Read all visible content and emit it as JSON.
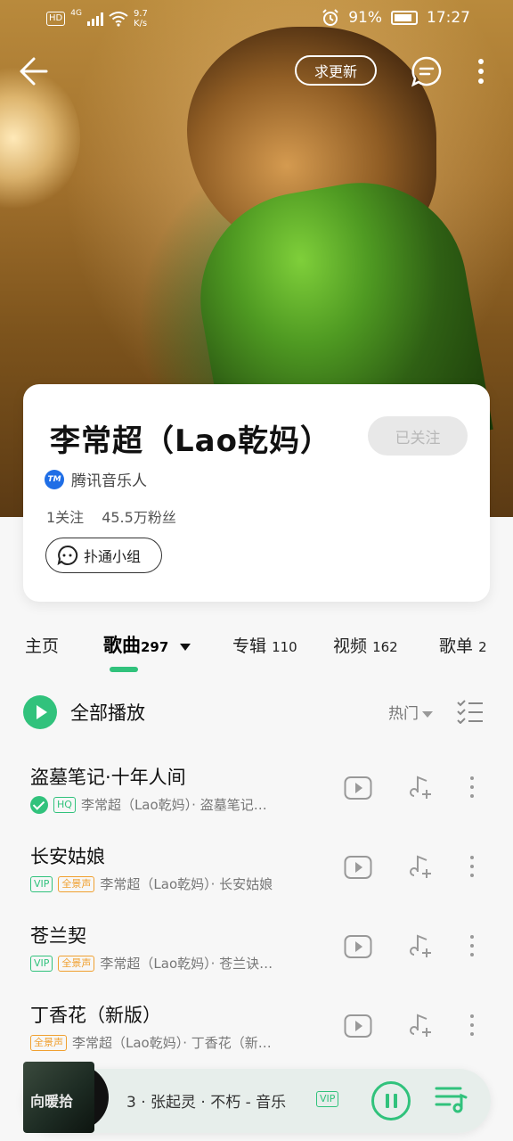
{
  "status_bar": {
    "hd": "HD",
    "network": "4G",
    "speed_value": "9.7",
    "speed_unit": "K/s",
    "battery": "91%",
    "time": "17:27"
  },
  "topnav": {
    "request_update": "求更新"
  },
  "artist": {
    "name": "李常超（Lao乾妈）",
    "follow_state": "已关注",
    "cert_label": "腾讯音乐人",
    "cert_icon_text": "TM",
    "following": "1关注",
    "fans": "45.5万粉丝",
    "group_label": "扑通小组"
  },
  "tabs": [
    {
      "label": "主页",
      "count": ""
    },
    {
      "label": "歌曲",
      "count": "297"
    },
    {
      "label": "专辑",
      "count": "110"
    },
    {
      "label": "视频",
      "count": "162"
    },
    {
      "label": "歌单",
      "count": "2"
    }
  ],
  "list_header": {
    "play_all": "全部播放",
    "sort": "热门"
  },
  "songs": [
    {
      "title": "盗墓笔记·十年人间",
      "tags": [
        "HQ"
      ],
      "meta": "李常超（Lao乾妈）· 盗墓笔记…",
      "downloaded": true
    },
    {
      "title": "长安姑娘",
      "tags": [
        "VIP",
        "全景声"
      ],
      "meta": "李常超（Lao乾妈）· 长安姑娘"
    },
    {
      "title": "苍兰契",
      "tags": [
        "VIP",
        "全景声"
      ],
      "meta": "李常超（Lao乾妈）· 苍兰诀…"
    },
    {
      "title": "丁香花（新版）",
      "tags": [
        "全景声"
      ],
      "meta": "李常超（Lao乾妈）· 丁香花（新…"
    }
  ],
  "player": {
    "cover_text": "向暖拾",
    "now_playing": "3 · 张起灵 · 不朽 - 音乐",
    "vip": "VIP"
  },
  "colors": {
    "accent": "#31c27c",
    "tag_orange": "#f0a030"
  }
}
